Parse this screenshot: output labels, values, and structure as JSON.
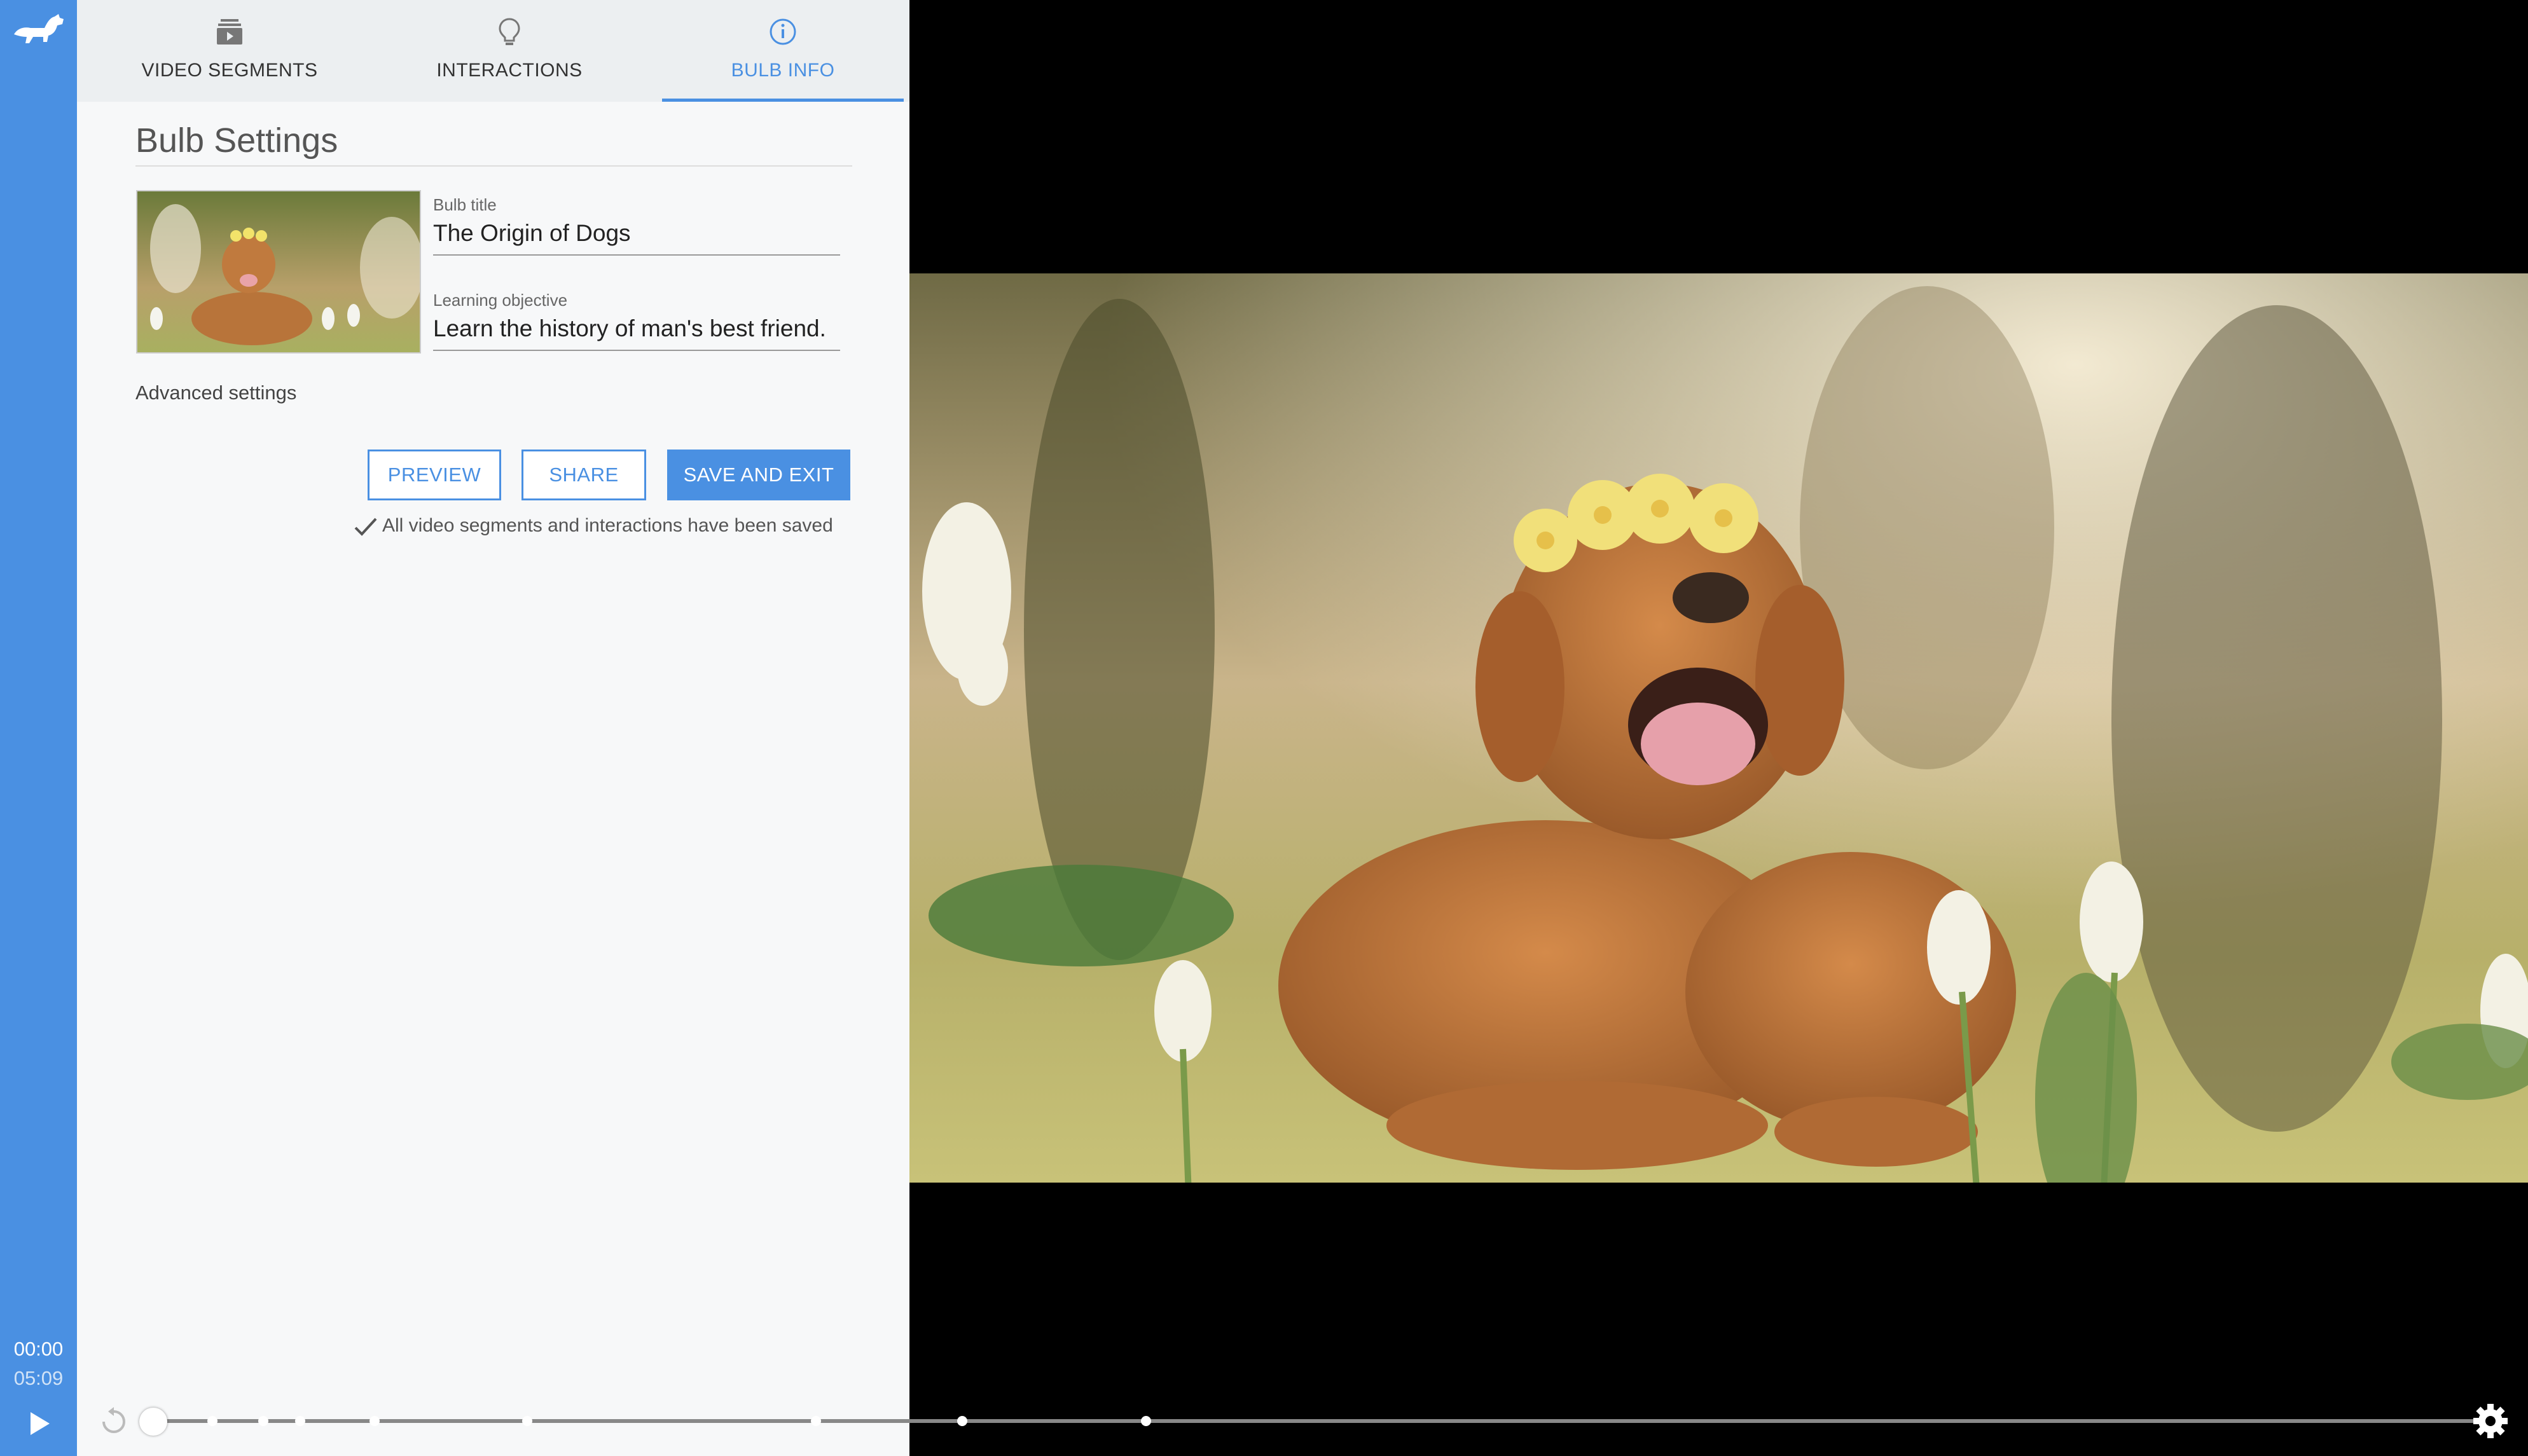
{
  "app": {
    "logo_icon": "dog-logo-icon",
    "accent": "#4a90e2"
  },
  "tabs": [
    {
      "label": "VIDEO SEGMENTS",
      "icon": "video-stack-icon",
      "active": false
    },
    {
      "label": "INTERACTIONS",
      "icon": "lightbulb-icon",
      "active": false
    },
    {
      "label": "BULB INFO",
      "icon": "info-icon",
      "active": true
    }
  ],
  "settings": {
    "title": "Bulb Settings",
    "bulb_title_label": "Bulb title",
    "bulb_title_value": "The Origin of Dogs",
    "objective_label": "Learning objective",
    "objective_value": "Learn the history of man's best friend.",
    "advanced_label": "Advanced settings",
    "preview_label": "PREVIEW",
    "share_label": "SHARE",
    "save_label": "SAVE AND EXIT",
    "saved_message": "All video segments and interactions have been saved"
  },
  "player": {
    "current_time": "00:00",
    "duration": "05:09",
    "progress": 0.0
  }
}
